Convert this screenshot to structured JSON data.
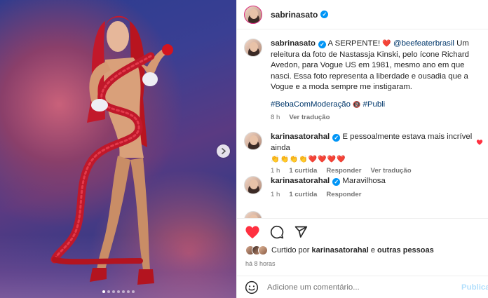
{
  "post": {
    "author": "sabrinasato",
    "header_username": "sabrinasato",
    "slides_count": 7,
    "active_slide": 0
  },
  "caption": {
    "username": "sabrinasato",
    "headline": "A SERPENTE! ",
    "heart_emoji": "❤️",
    "mention": "@beefeaterbrasil",
    "body": "Um releitura da foto de Nastassja Kinski, pelo ícone Richard Avedon, para Vogue US em 1981, mesmo ano em que nasci. Essa foto representa a liberdade e ousadia que a Vogue e a moda sempre me instigaram.",
    "hashtag1": "#BebaComModeração",
    "age_emoji": "🔞",
    "hashtag2": "#Publi",
    "time": "8 h",
    "translate": "Ver tradução"
  },
  "comments": [
    {
      "username": "karinasatorahal",
      "text": "E pessoalmente estava mais incrível ainda",
      "emoji_line": "👏👏👏👏❤️❤️❤️❤️",
      "time": "1 h",
      "likes": "1 curtida",
      "reply": "Responder",
      "translate": "Ver tradução"
    },
    {
      "username": "karinasatorahal",
      "text": "Maravilhosa",
      "time": "1 h",
      "likes": "1 curtida",
      "reply": "Responder"
    }
  ],
  "likes_line": {
    "prefix": "Curtido por ",
    "user": "karinasatorahal",
    "middle": " e ",
    "others": "outras pessoas"
  },
  "timestamp": "há 8 horas",
  "comment_input": {
    "placeholder": "Adicione um comentário...",
    "post_label": "Publicar"
  },
  "colors": {
    "like_red": "#ff3040",
    "verified_blue": "#0095f6",
    "link_blue": "#00376b",
    "muted": "#737373"
  },
  "icons": [
    "verified-icon",
    "heart-icon",
    "comment-icon",
    "share-icon",
    "emoji-icon",
    "chevron-right-icon"
  ]
}
